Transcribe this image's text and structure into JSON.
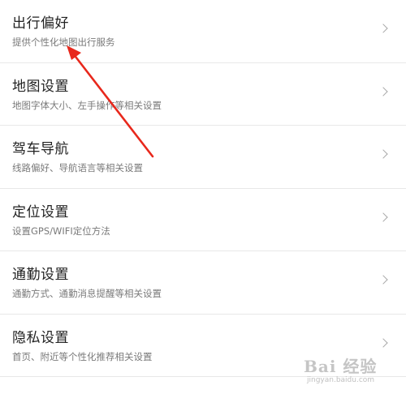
{
  "settings": {
    "items": [
      {
        "title": "出行偏好",
        "subtitle": "提供个性化地图出行服务",
        "icon": "chevron-right-icon"
      },
      {
        "title": "地图设置",
        "subtitle": "地图字体大小、左手操作等相关设置",
        "icon": "chevron-right-icon"
      },
      {
        "title": "驾车导航",
        "subtitle": "线路偏好、导航语言等相关设置",
        "icon": "chevron-right-icon"
      },
      {
        "title": "定位设置",
        "subtitle": "设置GPS/WIFI定位方法",
        "icon": "chevron-right-icon"
      },
      {
        "title": "通勤设置",
        "subtitle": "通勤方式、通勤消息提醒等相关设置",
        "icon": "chevron-right-icon"
      },
      {
        "title": "隐私设置",
        "subtitle": "首页、附近等个性化推荐相关设置",
        "icon": "chevron-right-icon"
      }
    ]
  },
  "colors": {
    "title": "#222222",
    "subtitle": "#7a7a7a",
    "divider": "#e8e8e8",
    "annotation": "#e8281c"
  },
  "watermark": {
    "main": "Bai 经验",
    "sub": "jingyan.baidu.com"
  }
}
